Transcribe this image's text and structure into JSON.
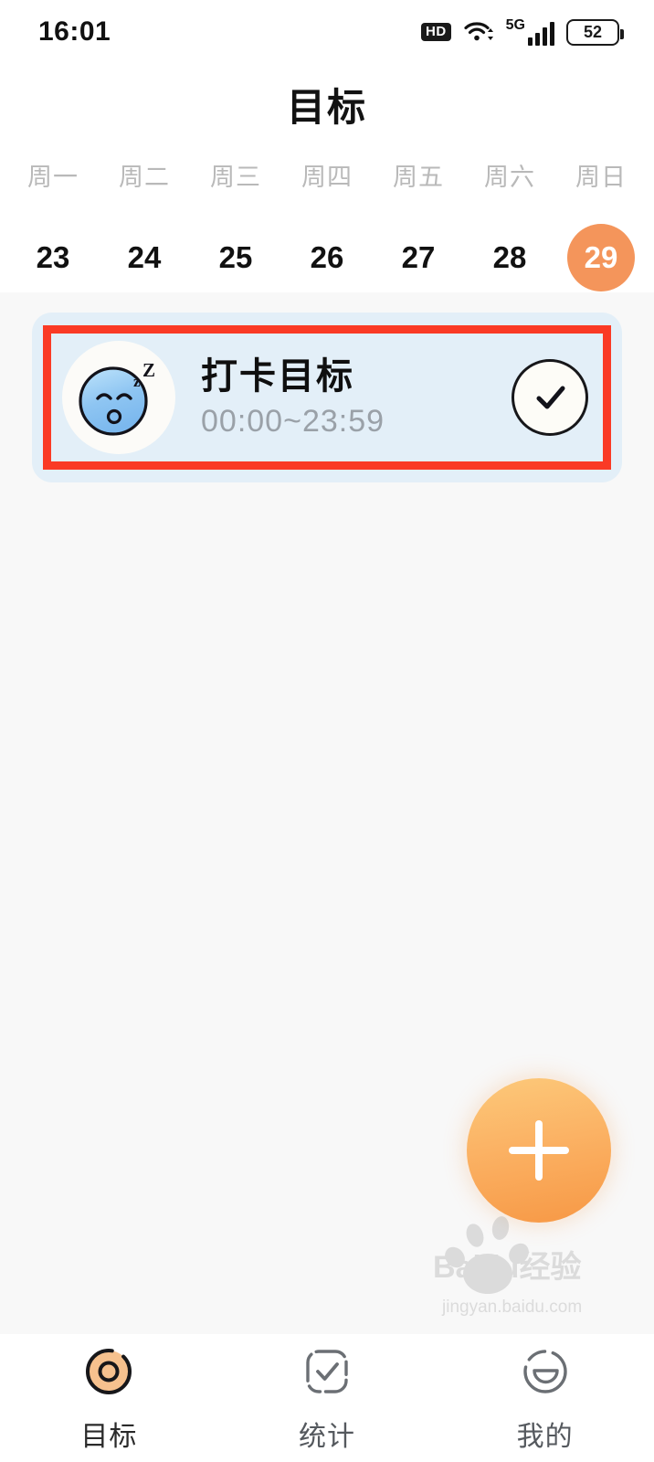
{
  "status_bar": {
    "time": "16:01",
    "hd_label": "HD",
    "network_label": "5G",
    "battery_level": "52",
    "icons": [
      "hd-badge-icon",
      "wifi-icon",
      "cellular-signal-icon",
      "battery-icon"
    ]
  },
  "header": {
    "title": "目标"
  },
  "week_strip": {
    "days": [
      {
        "name": "周一",
        "date": "23",
        "selected": false
      },
      {
        "name": "周二",
        "date": "24",
        "selected": false
      },
      {
        "name": "周三",
        "date": "25",
        "selected": false
      },
      {
        "name": "周四",
        "date": "26",
        "selected": false
      },
      {
        "name": "周五",
        "date": "27",
        "selected": false
      },
      {
        "name": "周六",
        "date": "28",
        "selected": false
      },
      {
        "name": "周日",
        "date": "29",
        "selected": true
      }
    ],
    "selected_color": "#F4955B"
  },
  "task_card": {
    "icon": "sleeping-face-icon",
    "title": "打卡目标",
    "time_range": "00:00~23:59",
    "complete_icon": "check-circle-icon",
    "card_color": "#E3EFF8",
    "annotation_color": "#FA3A25",
    "annotation": "red-highlight-box"
  },
  "fab": {
    "icon": "plus-icon",
    "gradient_from": "#FCC97A",
    "gradient_to": "#F79845"
  },
  "bottom_nav": {
    "items": [
      {
        "label": "目标",
        "icon": "target-icon",
        "active": true
      },
      {
        "label": "统计",
        "icon": "checklist-square-icon",
        "active": false
      },
      {
        "label": "我的",
        "icon": "smiley-face-icon",
        "active": false
      }
    ]
  },
  "watermark": {
    "brand": "Baidu经验",
    "url": "jingyan.baidu.com"
  }
}
